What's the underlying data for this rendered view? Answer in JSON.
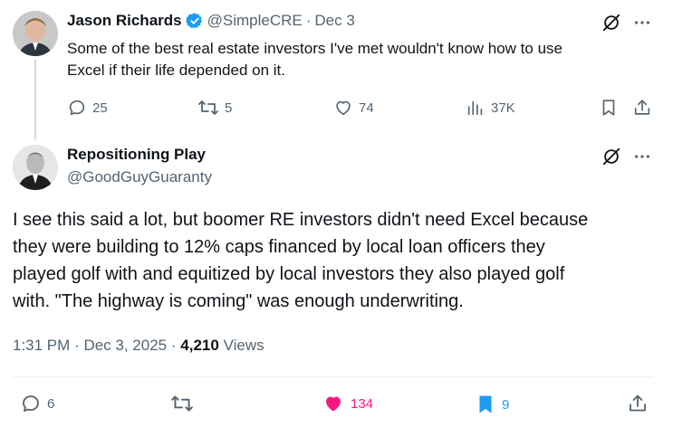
{
  "tweet1": {
    "author_name": "Jason Richards",
    "handle": "@SimpleCRE",
    "separator": "·",
    "date": "Dec 3",
    "text_line1": "Some of the best real estate investors I've met wouldn't know how to use",
    "text_line2": "Excel if their life depended on it.",
    "replies": "25",
    "reposts": "5",
    "likes": "74",
    "views": "37K"
  },
  "reply": {
    "author_name": "Repositioning Play",
    "handle": "@GoodGuyGuaranty",
    "text_lines": [
      "I see this said a lot, but boomer RE investors didn't need Excel because",
      "they were building to 12% caps financed by local loan officers they",
      "played golf with and equitized by local investors they also played golf",
      "with. \"The highway is coming\" was enough underwriting."
    ],
    "time": "1:31 PM",
    "sep1": "·",
    "date": "Dec 3, 2025",
    "sep2": "·",
    "views_count": "4,210",
    "views_label": "Views",
    "replies": "6",
    "likes": "134",
    "bookmarks": "9"
  },
  "colors": {
    "verified": "#1d9bf0",
    "liked": "#f91880",
    "bookmarked": "#1d9bf0",
    "muted": "#536471"
  }
}
